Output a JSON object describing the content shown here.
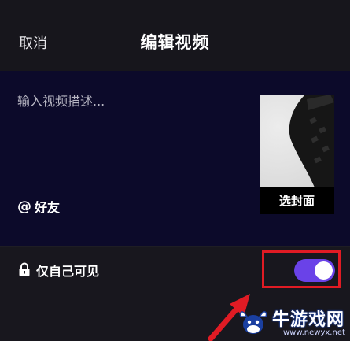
{
  "header": {
    "cancel_label": "取消",
    "title": "编辑视频"
  },
  "editor": {
    "description_placeholder": "输入视频描述...",
    "mention_symbol": "@",
    "mention_label": "好友",
    "cover_button_label": "选封面"
  },
  "privacy": {
    "icon": "lock-icon",
    "label": "仅自己可见",
    "toggle_on": true,
    "toggle_color": "#6a42e8"
  },
  "annotation": {
    "highlight_color": "#e01b24"
  },
  "watermark": {
    "name": "牛游戏网",
    "url": "www.newyx.net"
  }
}
